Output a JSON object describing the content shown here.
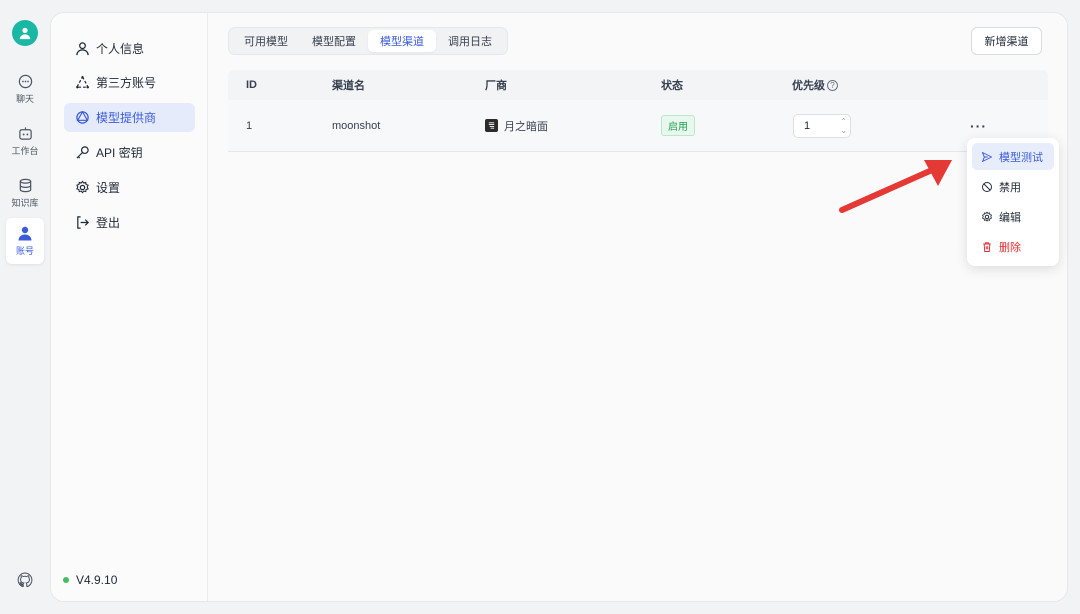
{
  "rail": {
    "items": [
      {
        "label": "聊天",
        "icon": "chat-icon"
      },
      {
        "label": "工作台",
        "icon": "robot-icon"
      },
      {
        "label": "知识库",
        "icon": "database-icon"
      },
      {
        "label": "账号",
        "icon": "user-icon"
      }
    ]
  },
  "sidebar": {
    "items": [
      {
        "label": "个人信息",
        "icon": "user-outline-icon"
      },
      {
        "label": "第三方账号",
        "icon": "triangle-nodes-icon"
      },
      {
        "label": "模型提供商",
        "icon": "provider-icon"
      },
      {
        "label": "API 密钥",
        "icon": "key-icon"
      },
      {
        "label": "设置",
        "icon": "gear-icon"
      },
      {
        "label": "登出",
        "icon": "logout-icon"
      }
    ],
    "version": "V4.9.10"
  },
  "tabs": [
    "可用模型",
    "模型配置",
    "模型渠道",
    "调用日志"
  ],
  "active_tab": "模型渠道",
  "new_channel_label": "新增渠道",
  "table": {
    "headers": {
      "id": "ID",
      "name": "渠道名",
      "vendor": "厂商",
      "status": "状态",
      "priority": "优先级"
    },
    "rows": [
      {
        "id": "1",
        "name": "moonshot",
        "vendor": "月之暗面",
        "status": "启用",
        "priority": "1"
      }
    ]
  },
  "menu": {
    "items": [
      {
        "label": "模型测试",
        "icon": "send-icon"
      },
      {
        "label": "禁用",
        "icon": "ban-icon"
      },
      {
        "label": "编辑",
        "icon": "gear-icon"
      },
      {
        "label": "删除",
        "icon": "trash-icon"
      }
    ]
  },
  "colors": {
    "accent": "#3b5bdb",
    "avatar": "#19b8a4",
    "status_green": "#22a14f",
    "danger": "#e03131",
    "annotation_arrow": "#e53935"
  }
}
